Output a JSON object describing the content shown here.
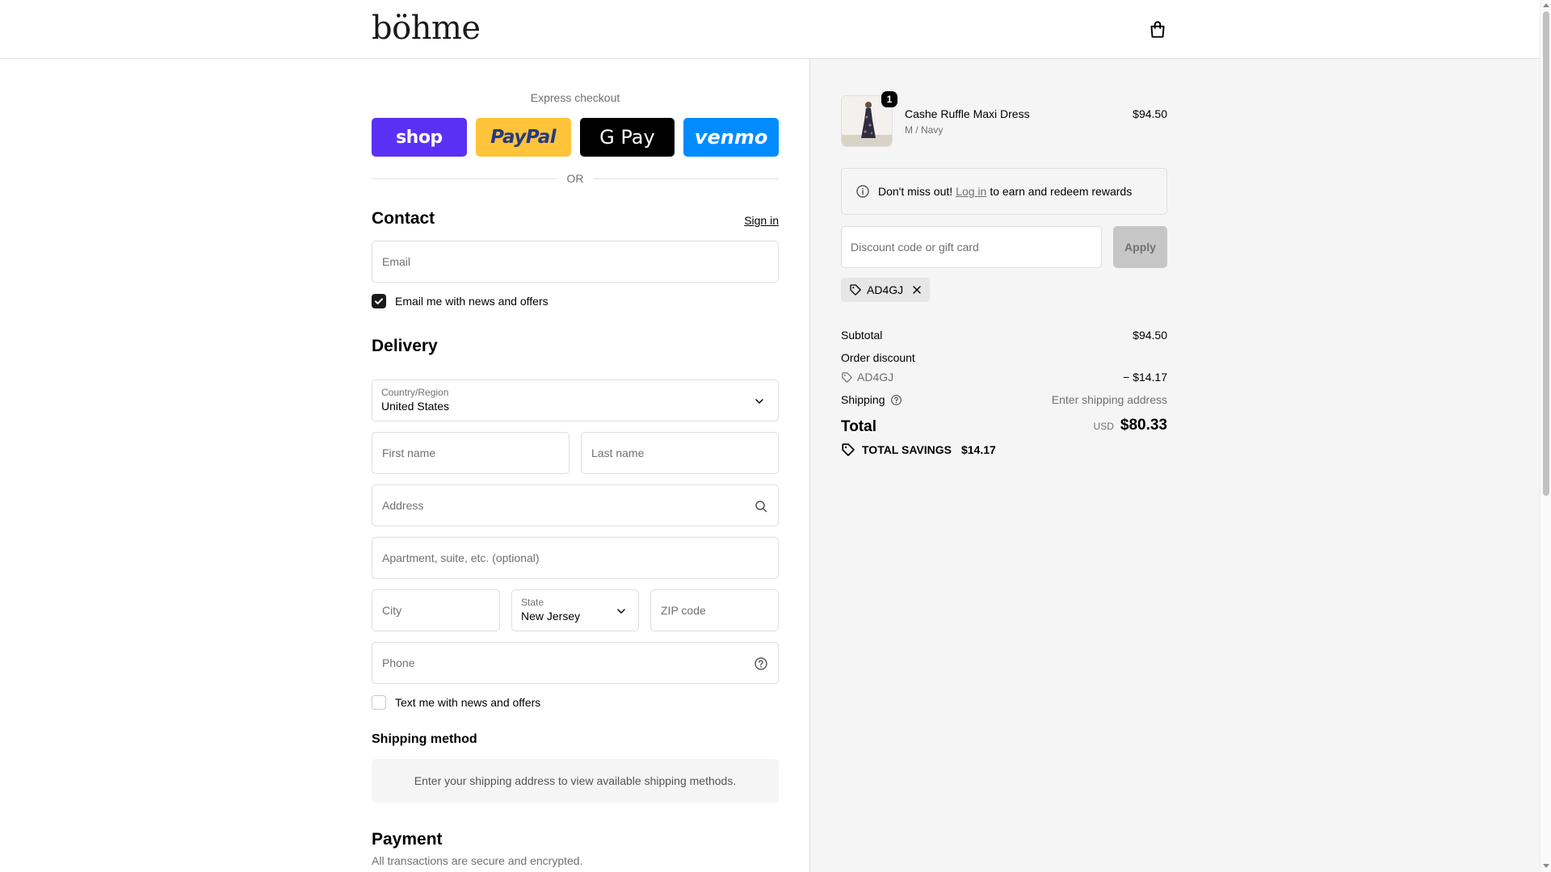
{
  "header": {
    "logo": "böhme",
    "cart_icon": "shopping-bag-icon"
  },
  "express": {
    "title": "Express checkout",
    "buttons": [
      {
        "label": "shop",
        "color": "#5a31f4"
      },
      {
        "label": "PayPal",
        "color": "#ffc439"
      },
      {
        "label": "G Pay",
        "color": "#000000"
      },
      {
        "label": "venmo",
        "color": "#008cff"
      }
    ],
    "or_label": "OR"
  },
  "contact": {
    "title": "Contact",
    "sign_in": "Sign in",
    "email_placeholder": "Email",
    "news_checkbox_label": "Email me with news and offers",
    "news_checked": true
  },
  "delivery": {
    "title": "Delivery",
    "country_label": "Country/Region",
    "country_value": "United States",
    "first_name_placeholder": "First name",
    "last_name_placeholder": "Last name",
    "address_placeholder": "Address",
    "apartment_placeholder": "Apartment, suite, etc. (optional)",
    "city_placeholder": "City",
    "state_label": "State",
    "state_value": "New Jersey",
    "zip_placeholder": "ZIP code",
    "phone_placeholder": "Phone",
    "text_checkbox_label": "Text me with news and offers",
    "text_checked": false
  },
  "shipping_method": {
    "title": "Shipping method",
    "message": "Enter your shipping address to view available shipping methods."
  },
  "payment": {
    "title": "Payment",
    "subtitle": "All transactions are secure and encrypted."
  },
  "summary": {
    "item": {
      "name": "Cashe Ruffle Maxi Dress",
      "variant": "M / Navy",
      "price": "$94.50",
      "quantity": "1"
    },
    "rewards_notice": {
      "before": "Don't miss out!",
      "link": "Log in",
      "after": "to earn and redeem rewards"
    },
    "discount_placeholder": "Discount code or gift card",
    "apply_label": "Apply",
    "applied_code": "AD4GJ",
    "subtotal_label": "Subtotal",
    "subtotal_value": "$94.50",
    "order_discount_label": "Order discount",
    "discount_code": "AD4GJ",
    "discount_value": "− $14.17",
    "shipping_label": "Shipping",
    "shipping_value": "Enter shipping address",
    "total_label": "Total",
    "currency": "USD",
    "total_value": "$80.33",
    "savings_label": "TOTAL SAVINGS",
    "savings_value": "$14.17"
  },
  "colors": {
    "shop": "#5a31f4",
    "paypal": "#ffc439",
    "gpay": "#000000",
    "venmo": "#008cff",
    "summary_bg": "#f5f5f5",
    "border": "#dedede"
  }
}
